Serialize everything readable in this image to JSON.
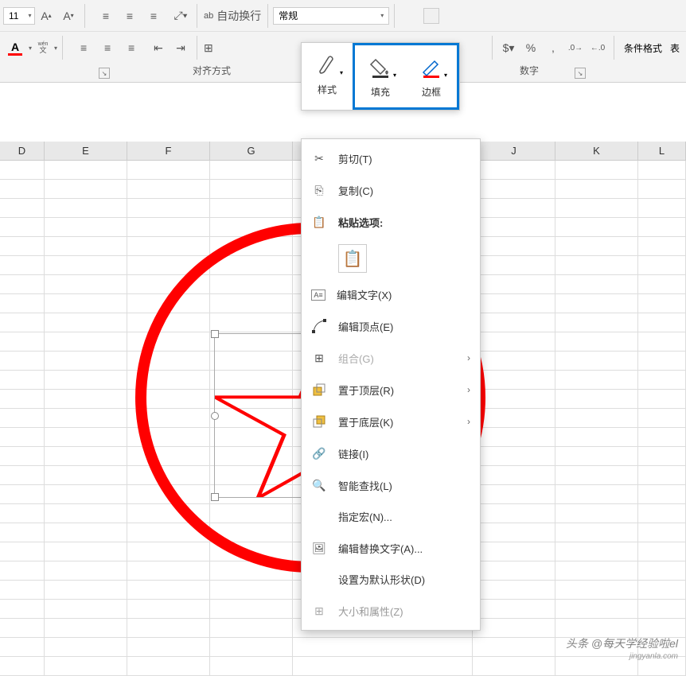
{
  "ribbon": {
    "font_size": "11",
    "wrap_text": "自动换行",
    "number_format": "常规",
    "conditional_format": "条件格式",
    "table": "表",
    "align_label": "对齐方式",
    "number_label": "数字",
    "wen_label": "文"
  },
  "floating_toolbar": {
    "style_label": "样式",
    "fill_label": "填充",
    "border_label": "边框"
  },
  "columns": [
    "D",
    "E",
    "F",
    "G",
    "",
    "J",
    "K",
    "L"
  ],
  "context_menu": {
    "cut": "剪切(T)",
    "copy": "复制(C)",
    "paste_options": "粘贴选项:",
    "edit_text": "编辑文字(X)",
    "edit_points": "编辑顶点(E)",
    "group": "组合(G)",
    "bring_front": "置于顶层(R)",
    "send_back": "置于底层(K)",
    "link": "链接(I)",
    "smart_lookup": "智能查找(L)",
    "assign_macro": "指定宏(N)...",
    "alt_text": "编辑替换文字(A)...",
    "set_default": "设置为默认形状(D)",
    "size_props": "大小和属性(Z)"
  },
  "watermark": "头条 @每天学经验啦el",
  "watermark_sub": "jingyanla.com"
}
